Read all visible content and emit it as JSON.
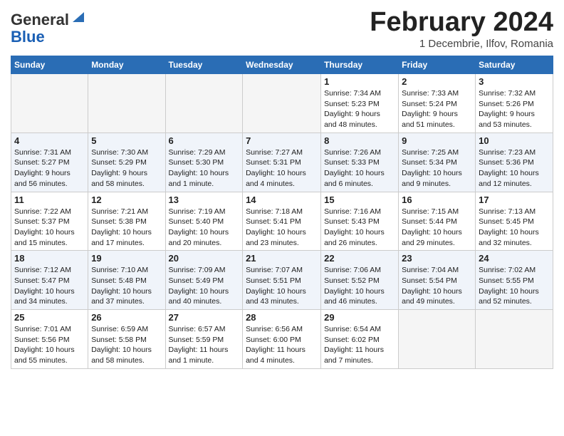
{
  "header": {
    "logo_line1": "General",
    "logo_line2": "Blue",
    "month": "February 2024",
    "subtitle": "1 Decembrie, Ilfov, Romania"
  },
  "weekdays": [
    "Sunday",
    "Monday",
    "Tuesday",
    "Wednesday",
    "Thursday",
    "Friday",
    "Saturday"
  ],
  "weeks": [
    [
      {
        "day": "",
        "info": ""
      },
      {
        "day": "",
        "info": ""
      },
      {
        "day": "",
        "info": ""
      },
      {
        "day": "",
        "info": ""
      },
      {
        "day": "1",
        "info": "Sunrise: 7:34 AM\nSunset: 5:23 PM\nDaylight: 9 hours\nand 48 minutes."
      },
      {
        "day": "2",
        "info": "Sunrise: 7:33 AM\nSunset: 5:24 PM\nDaylight: 9 hours\nand 51 minutes."
      },
      {
        "day": "3",
        "info": "Sunrise: 7:32 AM\nSunset: 5:26 PM\nDaylight: 9 hours\nand 53 minutes."
      }
    ],
    [
      {
        "day": "4",
        "info": "Sunrise: 7:31 AM\nSunset: 5:27 PM\nDaylight: 9 hours\nand 56 minutes."
      },
      {
        "day": "5",
        "info": "Sunrise: 7:30 AM\nSunset: 5:29 PM\nDaylight: 9 hours\nand 58 minutes."
      },
      {
        "day": "6",
        "info": "Sunrise: 7:29 AM\nSunset: 5:30 PM\nDaylight: 10 hours\nand 1 minute."
      },
      {
        "day": "7",
        "info": "Sunrise: 7:27 AM\nSunset: 5:31 PM\nDaylight: 10 hours\nand 4 minutes."
      },
      {
        "day": "8",
        "info": "Sunrise: 7:26 AM\nSunset: 5:33 PM\nDaylight: 10 hours\nand 6 minutes."
      },
      {
        "day": "9",
        "info": "Sunrise: 7:25 AM\nSunset: 5:34 PM\nDaylight: 10 hours\nand 9 minutes."
      },
      {
        "day": "10",
        "info": "Sunrise: 7:23 AM\nSunset: 5:36 PM\nDaylight: 10 hours\nand 12 minutes."
      }
    ],
    [
      {
        "day": "11",
        "info": "Sunrise: 7:22 AM\nSunset: 5:37 PM\nDaylight: 10 hours\nand 15 minutes."
      },
      {
        "day": "12",
        "info": "Sunrise: 7:21 AM\nSunset: 5:38 PM\nDaylight: 10 hours\nand 17 minutes."
      },
      {
        "day": "13",
        "info": "Sunrise: 7:19 AM\nSunset: 5:40 PM\nDaylight: 10 hours\nand 20 minutes."
      },
      {
        "day": "14",
        "info": "Sunrise: 7:18 AM\nSunset: 5:41 PM\nDaylight: 10 hours\nand 23 minutes."
      },
      {
        "day": "15",
        "info": "Sunrise: 7:16 AM\nSunset: 5:43 PM\nDaylight: 10 hours\nand 26 minutes."
      },
      {
        "day": "16",
        "info": "Sunrise: 7:15 AM\nSunset: 5:44 PM\nDaylight: 10 hours\nand 29 minutes."
      },
      {
        "day": "17",
        "info": "Sunrise: 7:13 AM\nSunset: 5:45 PM\nDaylight: 10 hours\nand 32 minutes."
      }
    ],
    [
      {
        "day": "18",
        "info": "Sunrise: 7:12 AM\nSunset: 5:47 PM\nDaylight: 10 hours\nand 34 minutes."
      },
      {
        "day": "19",
        "info": "Sunrise: 7:10 AM\nSunset: 5:48 PM\nDaylight: 10 hours\nand 37 minutes."
      },
      {
        "day": "20",
        "info": "Sunrise: 7:09 AM\nSunset: 5:49 PM\nDaylight: 10 hours\nand 40 minutes."
      },
      {
        "day": "21",
        "info": "Sunrise: 7:07 AM\nSunset: 5:51 PM\nDaylight: 10 hours\nand 43 minutes."
      },
      {
        "day": "22",
        "info": "Sunrise: 7:06 AM\nSunset: 5:52 PM\nDaylight: 10 hours\nand 46 minutes."
      },
      {
        "day": "23",
        "info": "Sunrise: 7:04 AM\nSunset: 5:54 PM\nDaylight: 10 hours\nand 49 minutes."
      },
      {
        "day": "24",
        "info": "Sunrise: 7:02 AM\nSunset: 5:55 PM\nDaylight: 10 hours\nand 52 minutes."
      }
    ],
    [
      {
        "day": "25",
        "info": "Sunrise: 7:01 AM\nSunset: 5:56 PM\nDaylight: 10 hours\nand 55 minutes."
      },
      {
        "day": "26",
        "info": "Sunrise: 6:59 AM\nSunset: 5:58 PM\nDaylight: 10 hours\nand 58 minutes."
      },
      {
        "day": "27",
        "info": "Sunrise: 6:57 AM\nSunset: 5:59 PM\nDaylight: 11 hours\nand 1 minute."
      },
      {
        "day": "28",
        "info": "Sunrise: 6:56 AM\nSunset: 6:00 PM\nDaylight: 11 hours\nand 4 minutes."
      },
      {
        "day": "29",
        "info": "Sunrise: 6:54 AM\nSunset: 6:02 PM\nDaylight: 11 hours\nand 7 minutes."
      },
      {
        "day": "",
        "info": ""
      },
      {
        "day": "",
        "info": ""
      }
    ]
  ]
}
